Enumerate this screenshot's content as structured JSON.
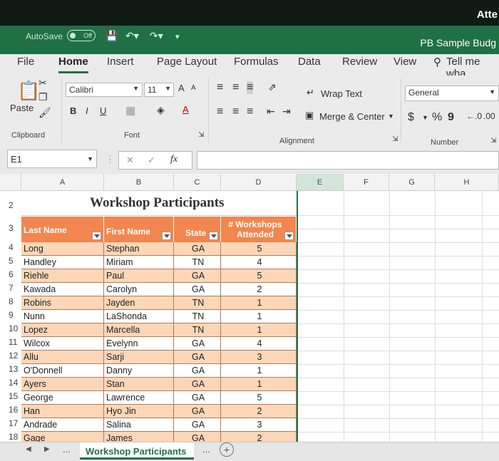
{
  "window": {
    "title_right": "Atte",
    "doc_title": "PB Sample Budg",
    "autosave": "AutoSave",
    "autosave_state": "Off"
  },
  "tabs": [
    "File",
    "Home",
    "Insert",
    "Page Layout",
    "Formulas",
    "Data",
    "Review",
    "View"
  ],
  "tell_me": "Tell me wha",
  "ribbon": {
    "clipboard": {
      "paste": "Paste",
      "group": "Clipboard"
    },
    "font": {
      "name": "Calibri",
      "size": "11",
      "bold": "B",
      "italic": "I",
      "underline": "U",
      "grow": "A",
      "shrink": "A",
      "group": "Font"
    },
    "alignment": {
      "wrap": "Wrap Text",
      "merge": "Merge & Center",
      "group": "Alignment"
    },
    "number": {
      "format": "General",
      "dollar": "$",
      "percent": "%",
      "comma": "9",
      "group": "Number"
    }
  },
  "formula_bar": {
    "name_box": "E1",
    "fx": "fx"
  },
  "columns": [
    "A",
    "B",
    "C",
    "D",
    "E",
    "F",
    "G",
    "H"
  ],
  "sheet": {
    "title": "Workshop Participants",
    "headers": [
      "Last Name",
      "First Name",
      "State",
      "# Workshops Attended"
    ],
    "rows": [
      {
        "n": "4",
        "last": "Long",
        "first": "Stephan",
        "state": "GA",
        "count": "5"
      },
      {
        "n": "5",
        "last": "Handley",
        "first": "Miriam",
        "state": "TN",
        "count": "4"
      },
      {
        "n": "6",
        "last": "Riehle",
        "first": "Paul",
        "state": "GA",
        "count": "5"
      },
      {
        "n": "7",
        "last": "Kawada",
        "first": "Carolyn",
        "state": "GA",
        "count": "2"
      },
      {
        "n": "8",
        "last": "Robins",
        "first": "Jayden",
        "state": "TN",
        "count": "1"
      },
      {
        "n": "9",
        "last": "Nunn",
        "first": "LaShonda",
        "state": "TN",
        "count": "1"
      },
      {
        "n": "10",
        "last": "Lopez",
        "first": "Marcella",
        "state": "TN",
        "count": "1"
      },
      {
        "n": "11",
        "last": "Wilcox",
        "first": "Evelynn",
        "state": "GA",
        "count": "4"
      },
      {
        "n": "12",
        "last": "Allu",
        "first": "Sarji",
        "state": "GA",
        "count": "3"
      },
      {
        "n": "13",
        "last": "O'Donnell",
        "first": "Danny",
        "state": "GA",
        "count": "1"
      },
      {
        "n": "14",
        "last": "Ayers",
        "first": "Stan",
        "state": "GA",
        "count": "1"
      },
      {
        "n": "15",
        "last": "George",
        "first": "Lawrence",
        "state": "GA",
        "count": "5"
      },
      {
        "n": "16",
        "last": "Han",
        "first": "Hyo Jin",
        "state": "GA",
        "count": "2"
      },
      {
        "n": "17",
        "last": "Andrade",
        "first": "Salina",
        "state": "GA",
        "count": "3"
      },
      {
        "n": "18",
        "last": "Gage",
        "first": "James",
        "state": "GA",
        "count": "2"
      }
    ]
  },
  "sheet_tabs": {
    "active": "Workshop Participants",
    "more": "..."
  },
  "colors": {
    "excel_green": "#1f7145",
    "header_orange": "#f2864e",
    "band": "#fbd7b8"
  }
}
